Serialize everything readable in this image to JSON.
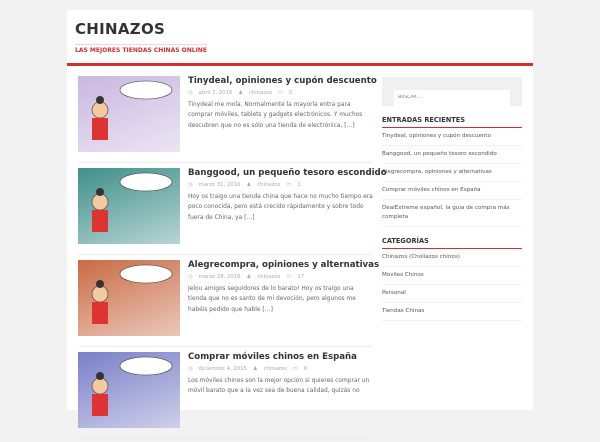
{
  "site": {
    "title": "CHINAZOS",
    "tagline": "LAS MEJORES TIENDAS CHINAS ONLINE"
  },
  "posts": [
    {
      "title": "Tinydeal, opiniones y cupón descuento",
      "date": "abril 7, 2016",
      "author": "chinazos",
      "comments": "0",
      "excerpt": "Tinydeal me mola. Normalmente la mayoría entra para comprar móviles, tablets y gadgets electrónicos. Y muchos descubren que no es sólo una tienda de electrónica, […]",
      "bg": "#c9b8e0"
    },
    {
      "title": "Banggood, un pequeño tesoro escondido",
      "date": "marzo 31, 2016",
      "author": "chinazos",
      "comments": "1",
      "excerpt": "Hoy os traigo una tienda china que hace no mucho tiempo era poco conocida, pero está crecido rápidamente y sobre todo fuera de China, ya […]",
      "bg": "#3f8f8a"
    },
    {
      "title": "Alegrecompra, opiniones y alternativas",
      "date": "marzo 28, 2016",
      "author": "chinazos",
      "comments": "17",
      "excerpt": "Jelou amigos seguidores de lo barato! Hoy os traigo una tienda que no es santo de mi devoción, pero algunos me habéis pedido que hable […]",
      "bg": "#c96b45"
    },
    {
      "title": "Comprar móviles chinos en España",
      "date": "diciembre 4, 2015",
      "author": "chinazos",
      "comments": "0",
      "excerpt": "Los móviles chinos son la mejor opción si quieres comprar un móvil barato que a la vez sea de buena calidad, quizás no",
      "bg": "#7a7fc8"
    }
  ],
  "sidebar": {
    "search_placeholder": "BUSCAR ...",
    "recent_title": "ENTRADAS RECIENTES",
    "recent": [
      "Tinydeal, opiniones y cupón descuento",
      "Banggood, un pequeño tesoro escondido",
      "Alegrecompra, opiniones y alternativas",
      "Comprar móviles chinos en España",
      "DealExtreme español, la guia de compra más completa"
    ],
    "cat_title": "CATEGORÍAS",
    "categories": [
      "Chinazos (Chollazos chinos)",
      "Moviles Chinos",
      "Personal",
      "Tiendas Chinas"
    ]
  }
}
